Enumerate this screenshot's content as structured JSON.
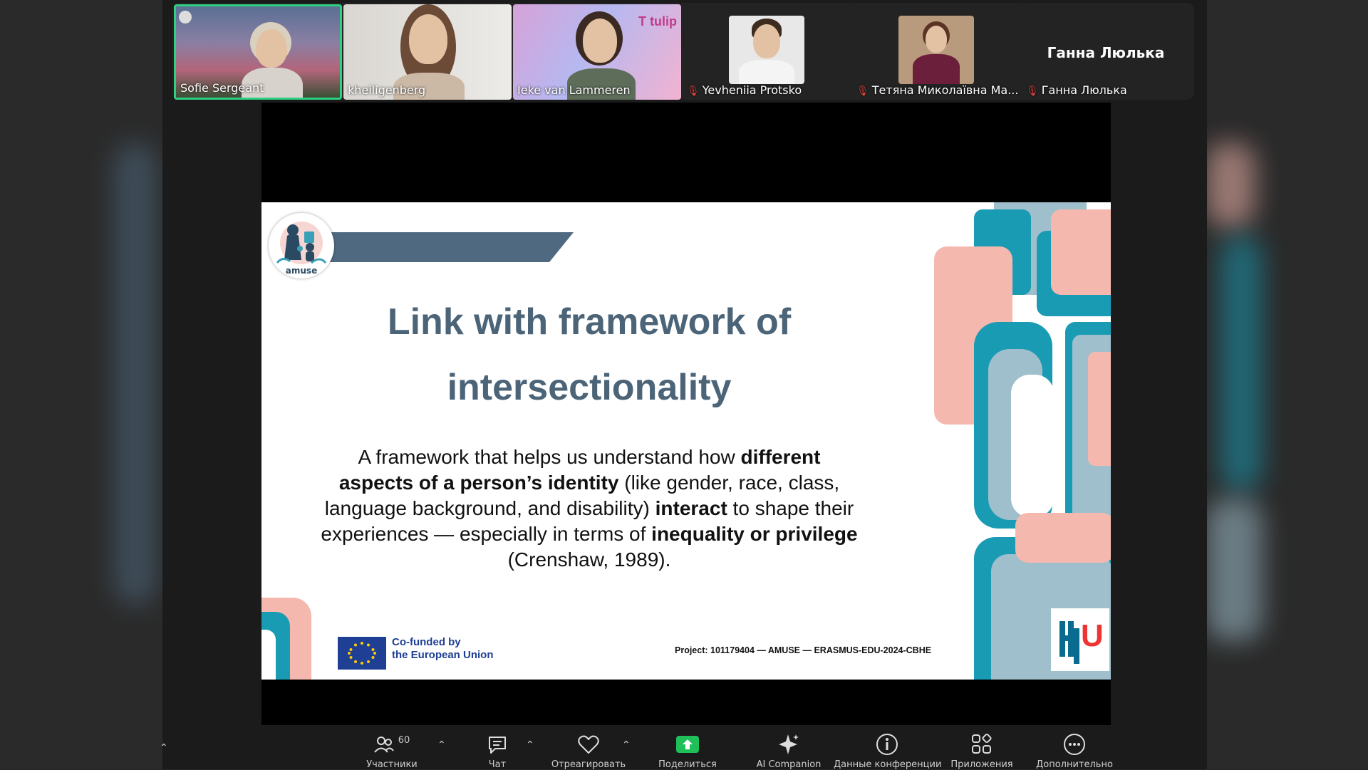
{
  "participants": [
    {
      "name": "Sofie Sergeant",
      "muted": false,
      "active": true
    },
    {
      "name": "kheiligenberg",
      "muted": false,
      "active": false
    },
    {
      "name": "Ieke van Lammeren",
      "muted": false,
      "active": false
    },
    {
      "name": "Yevheniia Protsko",
      "muted": true,
      "active": false
    },
    {
      "name": "Тетяна Миколаївна Ма...",
      "muted": true,
      "active": false
    },
    {
      "name": "Ганна Люлька",
      "muted": true,
      "active": false,
      "display_name": "Ганна Люлька"
    }
  ],
  "tile_overlay_text": "T tulip",
  "slide": {
    "title_line1": "Link with framework of",
    "title_line2": "intersectionality",
    "body_parts": [
      {
        "text": "A framework that helps us understand how ",
        "bold": false
      },
      {
        "text": "different aspects of a person’s identity",
        "bold": true
      },
      {
        "text": " (like gender, race, class, language background, and disability) ",
        "bold": false
      },
      {
        "text": "interact",
        "bold": true
      },
      {
        "text": " to shape their experiences — especially in terms of ",
        "bold": false
      },
      {
        "text": "inequality or privilege",
        "bold": true
      },
      {
        "text": " (Crenshaw, 1989).",
        "bold": false
      }
    ],
    "logo_text": "amuse",
    "eu_line1": "Co-funded by",
    "eu_line2": "the European Union",
    "project": "Project: 101179404 — AMUSE — ERASMUS-EDU-2024-CBHE",
    "hu_logo": "U"
  },
  "toolbar": {
    "participants_count": "60",
    "items": [
      {
        "label": "Участники",
        "icon": "participants-icon"
      },
      {
        "label": "Чат",
        "icon": "chat-icon"
      },
      {
        "label": "Отреагировать",
        "icon": "heart-icon"
      },
      {
        "label": "Поделиться",
        "icon": "share-screen-icon"
      },
      {
        "label": "AI Companion",
        "icon": "sparkle-icon"
      },
      {
        "label": "Данные конференции",
        "icon": "info-icon"
      },
      {
        "label": "Приложения",
        "icon": "apps-icon"
      },
      {
        "label": "Дополнительно",
        "icon": "more-icon"
      }
    ]
  },
  "colors": {
    "slide_title": "#4c6478",
    "banner": "#4f6a80",
    "teal": "#1a9bb4",
    "pink": "#f5b8ae",
    "grey_blue": "#9fbfcc",
    "active_border": "#2fd080",
    "share_green": "#1fbf5a"
  }
}
